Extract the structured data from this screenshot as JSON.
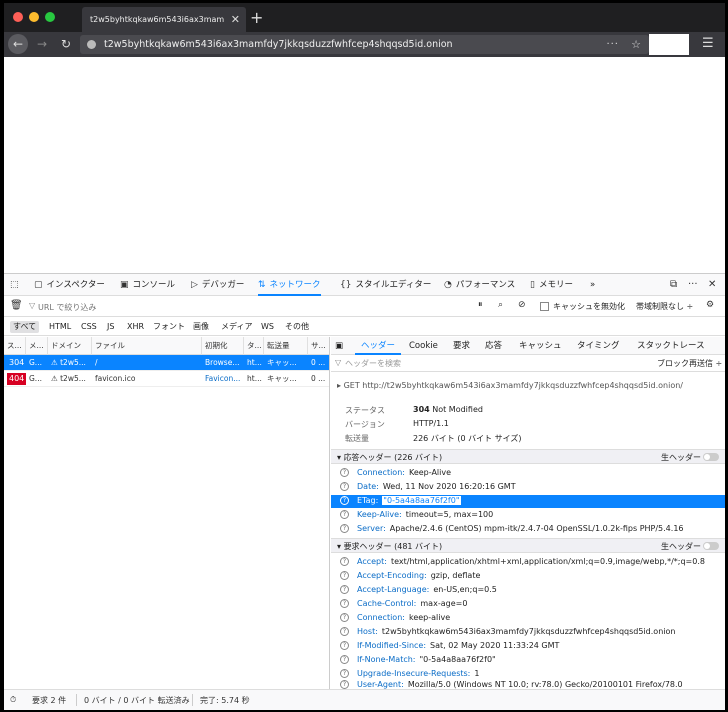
{
  "browser": {
    "tab_title": "t2w5byhtkqkaw6m543i6ax3mamfdy7jkkqsduzzfwhfcep4shqqsd5id.onion",
    "url": "t2w5byhtkqkaw6m543i6ax3mamfdy7jkkqsduzzfwhfcep4shqqsd5id.onion",
    "more_icon": "···",
    "star_icon": "☆"
  },
  "devtools": {
    "tabs": [
      {
        "icon": "▢",
        "label": "インスペクター"
      },
      {
        "icon": "▣",
        "label": "コンソール"
      },
      {
        "icon": "▷",
        "label": "デバッガー"
      },
      {
        "icon": "⇅",
        "label": "ネットワーク"
      },
      {
        "icon": "{}",
        "label": "スタイルエディター"
      },
      {
        "icon": "◔",
        "label": "パフォーマンス"
      },
      {
        "icon": "▯",
        "label": "メモリー"
      }
    ],
    "more_tabs": "»",
    "filter_placeholder": "URL で絞り込み",
    "disable_cache": "キャッシュを無効化",
    "throttle": "帯域制限なし ÷",
    "type_filters": [
      "すべて",
      "HTML",
      "CSS",
      "JS",
      "XHR",
      "フォント",
      "画像",
      "メディア",
      "WS",
      "その他"
    ],
    "columns": [
      "ス...",
      "メ...",
      "ドメイン",
      "ファイル",
      "初期化",
      "タ...",
      "転送量",
      "サ..."
    ],
    "requests": [
      {
        "status": "304",
        "method": "G...",
        "domain": "t2w5...",
        "file": "/",
        "initiator": "Browse...",
        "type": "ht...",
        "transferred": "キャッ...",
        "size": "0 ..."
      },
      {
        "status": "404",
        "method": "G...",
        "domain": "t2w5...",
        "file": "favicon.ico",
        "initiator": "Favicon...",
        "type": "ht...",
        "transferred": "キャッ...",
        "size": "0 ..."
      }
    ],
    "side_tabs": [
      "ヘッダー",
      "Cookie",
      "要求",
      "応答",
      "キャッシュ",
      "タイミング",
      "スタックトレース"
    ],
    "header_filter": "ヘッダーを検索",
    "block": "ブロック",
    "resend": "再送信 ÷",
    "get_line": "GET  http://t2w5byhtkqkaw6m543i6ax3mamfdy7jkkqsduzzfwhfcep4shqqsd5id.onion/",
    "summary": [
      {
        "label": "ステータス",
        "value": "304",
        "value_extra": "Not Modified"
      },
      {
        "label": "バージョン",
        "value": "HTTP/1.1",
        "value_extra": ""
      },
      {
        "label": "転送量",
        "value": "226 バイト (0 バイト サイズ)",
        "value_extra": ""
      }
    ],
    "response_headers_title": "応答ヘッダー (226 バイト)",
    "raw_headers_label": "生ヘッダー",
    "response_headers": [
      {
        "name": "Connection:",
        "value": "Keep-Alive"
      },
      {
        "name": "Date:",
        "value": "Wed, 11 Nov 2020 16:20:16 GMT"
      },
      {
        "name": "ETag:",
        "value": "\"0-5a4a8aa76f2f0\""
      },
      {
        "name": "Keep-Alive:",
        "value": "timeout=5, max=100"
      },
      {
        "name": "Server:",
        "value": "Apache/2.4.6 (CentOS) mpm-itk/2.4.7-04 OpenSSL/1.0.2k-fips PHP/5.4.16"
      }
    ],
    "request_headers_title": "要求ヘッダー (481 バイト)",
    "request_headers": [
      {
        "name": "Accept:",
        "value": "text/html,application/xhtml+xml,application/xml;q=0.9,image/webp,*/*;q=0.8"
      },
      {
        "name": "Accept-Encoding:",
        "value": "gzip, deflate"
      },
      {
        "name": "Accept-Language:",
        "value": "en-US,en;q=0.5"
      },
      {
        "name": "Cache-Control:",
        "value": "max-age=0"
      },
      {
        "name": "Connection:",
        "value": "keep-alive"
      },
      {
        "name": "Host:",
        "value": "t2w5byhtkqkaw6m543i6ax3mamfdy7jkkqsduzzfwhfcep4shqqsd5id.onion"
      },
      {
        "name": "If-Modified-Since:",
        "value": "Sat, 02 May 2020 11:33:24 GMT"
      },
      {
        "name": "If-None-Match:",
        "value": "\"0-5a4a8aa76f2f0\""
      },
      {
        "name": "Upgrade-Insecure-Requests:",
        "value": "1"
      },
      {
        "name": "User-Agent:",
        "value": "Mozilla/5.0 (Windows NT 10.0; rv:78.0) Gecko/20100101 Firefox/78.0"
      }
    ],
    "status_bar": {
      "requests": "要求 2 件",
      "transferred": "0 バイト / 0 バイト 転送済み",
      "finish": "完了: 5.74 秒"
    }
  },
  "colors": {
    "accent": "#0a84ff",
    "error_badge": "#d70022"
  }
}
